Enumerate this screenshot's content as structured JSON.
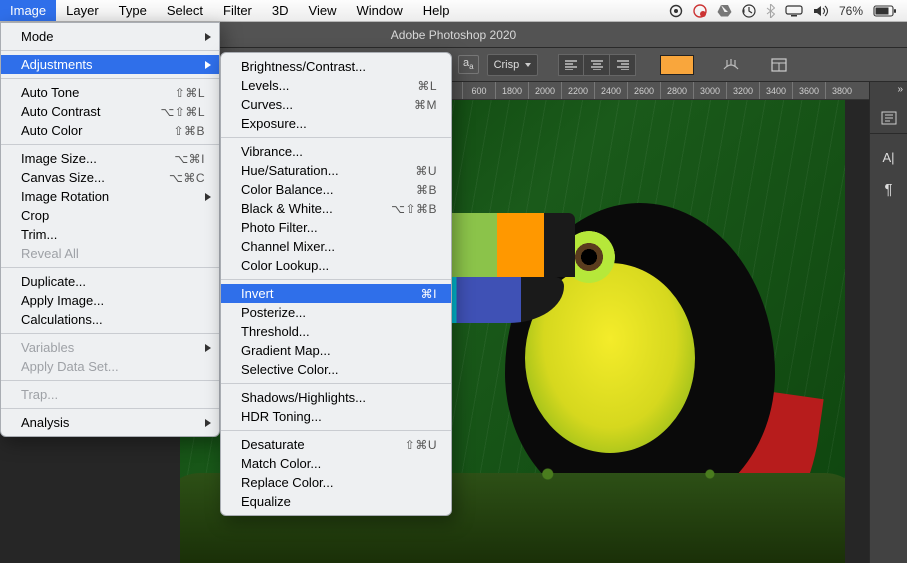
{
  "menubar": {
    "items": [
      "Image",
      "Layer",
      "Type",
      "Select",
      "Filter",
      "3D",
      "View",
      "Window",
      "Help"
    ],
    "active": "Image",
    "status": {
      "battery_pct": "76%"
    }
  },
  "app": {
    "title": "Adobe Photoshop 2020"
  },
  "options": {
    "aa_label": "a",
    "aa_sub": "a",
    "crisp": "Crisp",
    "color": "#f9a63c"
  },
  "ruler_ticks": [
    "",
    "",
    "",
    "",
    "",
    "",
    "",
    "",
    "",
    "",
    "",
    "",
    "",
    "",
    "600",
    "1800",
    "2000",
    "2200",
    "2400",
    "2600",
    "2800",
    "3000",
    "3200",
    "3400",
    "3600",
    "3800"
  ],
  "image_menu": [
    {
      "label": "Mode",
      "arrow": true
    },
    {
      "sep": true
    },
    {
      "label": "Adjustments",
      "arrow": true,
      "highlight": true
    },
    {
      "sep": true
    },
    {
      "label": "Auto Tone",
      "shortcut": "⇧⌘L"
    },
    {
      "label": "Auto Contrast",
      "shortcut": "⌥⇧⌘L"
    },
    {
      "label": "Auto Color",
      "shortcut": "⇧⌘B"
    },
    {
      "sep": true
    },
    {
      "label": "Image Size...",
      "shortcut": "⌥⌘I"
    },
    {
      "label": "Canvas Size...",
      "shortcut": "⌥⌘C"
    },
    {
      "label": "Image Rotation",
      "arrow": true
    },
    {
      "label": "Crop"
    },
    {
      "label": "Trim..."
    },
    {
      "label": "Reveal All",
      "disabled": true
    },
    {
      "sep": true
    },
    {
      "label": "Duplicate..."
    },
    {
      "label": "Apply Image..."
    },
    {
      "label": "Calculations..."
    },
    {
      "sep": true
    },
    {
      "label": "Variables",
      "arrow": true,
      "disabled": true
    },
    {
      "label": "Apply Data Set...",
      "disabled": true
    },
    {
      "sep": true
    },
    {
      "label": "Trap...",
      "disabled": true
    },
    {
      "sep": true
    },
    {
      "label": "Analysis",
      "arrow": true
    }
  ],
  "adjustments_menu": [
    {
      "label": "Brightness/Contrast..."
    },
    {
      "label": "Levels...",
      "shortcut": "⌘L"
    },
    {
      "label": "Curves...",
      "shortcut": "⌘M"
    },
    {
      "label": "Exposure..."
    },
    {
      "sep": true
    },
    {
      "label": "Vibrance..."
    },
    {
      "label": "Hue/Saturation...",
      "shortcut": "⌘U"
    },
    {
      "label": "Color Balance...",
      "shortcut": "⌘B"
    },
    {
      "label": "Black & White...",
      "shortcut": "⌥⇧⌘B"
    },
    {
      "label": "Photo Filter..."
    },
    {
      "label": "Channel Mixer..."
    },
    {
      "label": "Color Lookup..."
    },
    {
      "sep": true
    },
    {
      "label": "Invert",
      "shortcut": "⌘I",
      "highlight": true
    },
    {
      "label": "Posterize..."
    },
    {
      "label": "Threshold..."
    },
    {
      "label": "Gradient Map..."
    },
    {
      "label": "Selective Color..."
    },
    {
      "sep": true
    },
    {
      "label": "Shadows/Highlights..."
    },
    {
      "label": "HDR Toning..."
    },
    {
      "sep": true
    },
    {
      "label": "Desaturate",
      "shortcut": "⇧⌘U"
    },
    {
      "label": "Match Color..."
    },
    {
      "label": "Replace Color..."
    },
    {
      "label": "Equalize"
    }
  ],
  "right_panel": {
    "icons": [
      "properties-icon",
      "adjustments-icon",
      "character-icon",
      "paragraph-icon"
    ]
  }
}
